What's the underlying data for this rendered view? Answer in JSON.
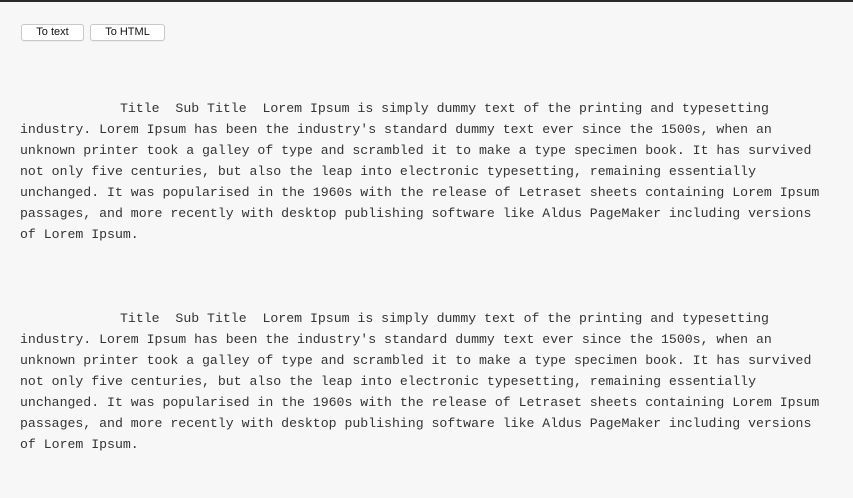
{
  "toolbar": {
    "to_text_label": "To text",
    "to_html_label": "To HTML"
  },
  "document": {
    "paragraphs": [
      {
        "title": "Title",
        "subtitle": "Sub Title",
        "body": "Lorem Ipsum is simply dummy text of the printing and typesetting industry. Lorem Ipsum has been the industry's standard dummy text ever since the 1500s, when an unknown printer took a galley of type and scrambled it to make a type specimen book. It has survived not only five centuries, but also the leap into electronic typesetting, remaining essentially unchanged. It was popularised in the 1960s with the release of Letraset sheets containing Lorem Ipsum passages, and more recently with desktop publishing software like Aldus PageMaker including versions of Lorem Ipsum."
      },
      {
        "title": "Title",
        "subtitle": "Sub Title",
        "body": "Lorem Ipsum is simply dummy text of the printing and typesetting industry. Lorem Ipsum has been the industry's standard dummy text ever since the 1500s, when an unknown printer took a galley of type and scrambled it to make a type specimen book. It has survived not only five centuries, but also the leap into electronic typesetting, remaining essentially unchanged. It was popularised in the 1960s with the release of Letraset sheets containing Lorem Ipsum passages, and more recently with desktop publishing software like Aldus PageMaker including versions of Lorem Ipsum."
      }
    ]
  }
}
